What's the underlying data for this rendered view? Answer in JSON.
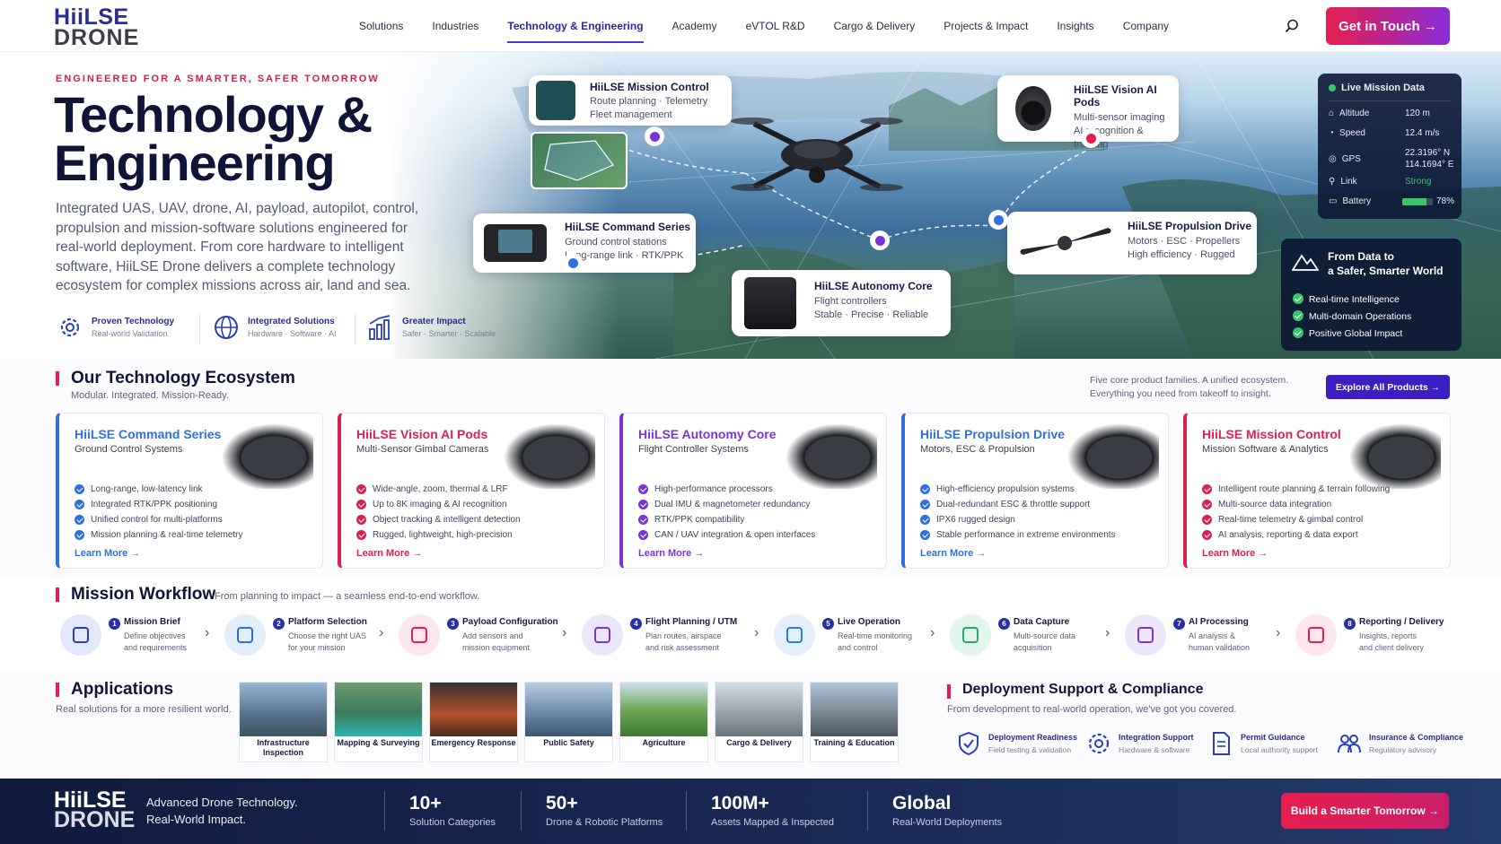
{
  "brand": {
    "logo_line1": "HiiLSE",
    "logo_line2": "DRONE"
  },
  "nav": {
    "items": [
      "Solutions",
      "Industries",
      "Technology & Engineering",
      "Academy",
      "eVTOL R&D",
      "Cargo & Delivery",
      "Projects & Impact",
      "Insights",
      "Company"
    ],
    "active": "Technology & Engineering",
    "cta": "Get in Touch →"
  },
  "hero": {
    "kicker": "ENGINEERED FOR A SMARTER, SAFER TOMORROW",
    "title_line1": "Technology &",
    "title_line2": "Engineering",
    "lead": "Integrated UAS, UAV, drone, AI, payload, autopilot, control, propulsion and mission-software solutions engineered for real-world deployment. From core hardware to intelligent software, HiiLSE Drone delivers a complete technology ecosystem for complex missions across air, land and sea.",
    "pillars": [
      {
        "title": "Proven Technology",
        "sub": "Real-world Validation",
        "icon": "gear-icon"
      },
      {
        "title": "Integrated Solutions",
        "sub": "Hardware · Software · AI",
        "icon": "globe-icon"
      },
      {
        "title": "Greater Impact",
        "sub": "Safer · Smarter · Scalable",
        "icon": "bar-chart-icon"
      }
    ],
    "callouts": [
      {
        "title": "HiiLSE Mission Control",
        "l1": "Route planning · Telemetry",
        "l2": "Fleet management"
      },
      {
        "title": "HiiLSE Vision AI Pods",
        "l1": "Multi-sensor imaging",
        "l2": "AI recognition & tracking"
      },
      {
        "title": "HiiLSE Command Series",
        "l1": "Ground control stations",
        "l2": "Long-range link · RTK/PPK"
      },
      {
        "title": "HiiLSE Propulsion Drive",
        "l1": "Motors · ESC · Propellers",
        "l2": "High efficiency · Rugged"
      },
      {
        "title": "HiiLSE Autonomy Core",
        "l1": "Flight controllers",
        "l2": "Stable · Precise · Reliable"
      }
    ],
    "live": {
      "title": "Live Mission Data",
      "rows": [
        {
          "k": "Altitude",
          "v": "120 m"
        },
        {
          "k": "Speed",
          "v": "12.4 m/s"
        },
        {
          "k": "GPS",
          "v": "22.3196° N",
          "v2": "114.1694° E"
        },
        {
          "k": "Link",
          "v": "Strong"
        },
        {
          "k": "Battery",
          "v": "78%"
        }
      ],
      "battery_level": 0.78
    },
    "from_data": {
      "title_l1": "From Data to",
      "title_l2": "a Safer, Smarter World",
      "items": [
        "Real-time Intelligence",
        "Multi-domain Operations",
        "Positive Global Impact"
      ]
    }
  },
  "ecosystem": {
    "title": "Our Technology Ecosystem",
    "subtitle": "Modular. Integrated. Mission-Ready.",
    "note_l1": "Five core product families. A unified ecosystem.",
    "note_l2": "Everything you need from takeoff to insight.",
    "button": "Explore All Products →",
    "cards": [
      {
        "title": "HiiLSE Command Series",
        "sub": "Ground Control Systems",
        "color": "#2f6fe0",
        "items": [
          "Long-range, low-latency link",
          "Integrated RTK/PPK positioning",
          "Unified control for multi-platforms",
          "Mission planning & real-time telemetry"
        ]
      },
      {
        "title": "HiiLSE Vision AI Pods",
        "sub": "Multi-Sensor Gimbal Cameras",
        "color": "#d8234f",
        "items": [
          "Wide-angle, zoom, thermal & LRF",
          "Up to 8K imaging & AI recognition",
          "Object tracking & intelligent detection",
          "Rugged, lightweight, high-precision"
        ]
      },
      {
        "title": "HiiLSE Autonomy Core",
        "sub": "Flight Controller Systems",
        "color": "#7b35d6",
        "items": [
          "High-performance processors",
          "Dual IMU & magnetometer redundancy",
          "RTK/PPK compatibility",
          "CAN / UAV integration & open interfaces"
        ]
      },
      {
        "title": "HiiLSE Propulsion Drive",
        "sub": "Motors, ESC & Propulsion",
        "color": "#2f6fe0",
        "items": [
          "High-efficiency propulsion systems",
          "Dual-redundant ESC & throttle support",
          "IPX6 rugged design",
          "Stable performance in extreme environments"
        ]
      },
      {
        "title": "HiiLSE Mission Control",
        "sub": "Mission Software & Analytics",
        "color": "#d8234f",
        "items": [
          "Intelligent route planning & terrain following",
          "Multi-source data integration",
          "Real-time telemetry & gimbal control",
          "AI analysis, reporting & data export"
        ]
      }
    ],
    "learn_more": "Learn More →"
  },
  "workflow": {
    "title": "Mission Workflow",
    "subtitle": "From planning to impact — a seamless end-to-end workflow.",
    "steps": [
      {
        "n": "1",
        "title": "Mission Brief",
        "d1": "Define objectives",
        "d2": "and requirements"
      },
      {
        "n": "2",
        "title": "Platform Selection",
        "d1": "Choose the right UAS",
        "d2": "for your mission"
      },
      {
        "n": "3",
        "title": "Payload Configuration",
        "d1": "Add sensors and",
        "d2": "mission equipment"
      },
      {
        "n": "4",
        "title": "Flight Planning / UTM",
        "d1": "Plan routes, airspace",
        "d2": "and risk assessment"
      },
      {
        "n": "5",
        "title": "Live Operation",
        "d1": "Real-time monitoring",
        "d2": "and control"
      },
      {
        "n": "6",
        "title": "Data Capture",
        "d1": "Multi-source data",
        "d2": "acquisition"
      },
      {
        "n": "7",
        "title": "AI Processing",
        "d1": "AI analysis &",
        "d2": "human validation"
      },
      {
        "n": "8",
        "title": "Reporting / Delivery",
        "d1": "Insights, reports",
        "d2": "and client delivery"
      }
    ]
  },
  "applications": {
    "title": "Applications",
    "subtitle": "Real solutions for a more resilient world.",
    "items": [
      "Infrastructure Inspection",
      "Mapping & Surveying",
      "Emergency Response",
      "Public Safety",
      "Agriculture",
      "Cargo & Delivery",
      "Training & Education"
    ]
  },
  "deployment": {
    "title": "Deployment Support & Compliance",
    "subtitle": "From development to real-world operation, we've got you covered.",
    "items": [
      {
        "title": "Deployment Readiness",
        "sub": "Field testing & validation",
        "icon": "shield-check-icon"
      },
      {
        "title": "Integration Support",
        "sub": "Hardware & software",
        "icon": "gear-icon"
      },
      {
        "title": "Permit Guidance",
        "sub": "Local authority support",
        "icon": "document-icon"
      },
      {
        "title": "Insurance & Compliance",
        "sub": "Regulatory advisory",
        "icon": "people-icon"
      }
    ]
  },
  "footer": {
    "tag_l1": "Advanced Drone Technology.",
    "tag_l2": "Real-World Impact.",
    "stats": [
      {
        "n": "10+",
        "l": "Solution Categories"
      },
      {
        "n": "50+",
        "l": "Drone & Robotic Platforms"
      },
      {
        "n": "100M+",
        "l": "Assets Mapped & Inspected"
      },
      {
        "n": "Global",
        "l": "Real-World Deployments"
      }
    ],
    "cta": "Build a Smarter Tomorrow →"
  },
  "colors": {
    "accent_red": "#e61e4d",
    "accent_purple": "#7b35d6",
    "navy": "#101538",
    "accent_blue": "#2f6fe0"
  }
}
